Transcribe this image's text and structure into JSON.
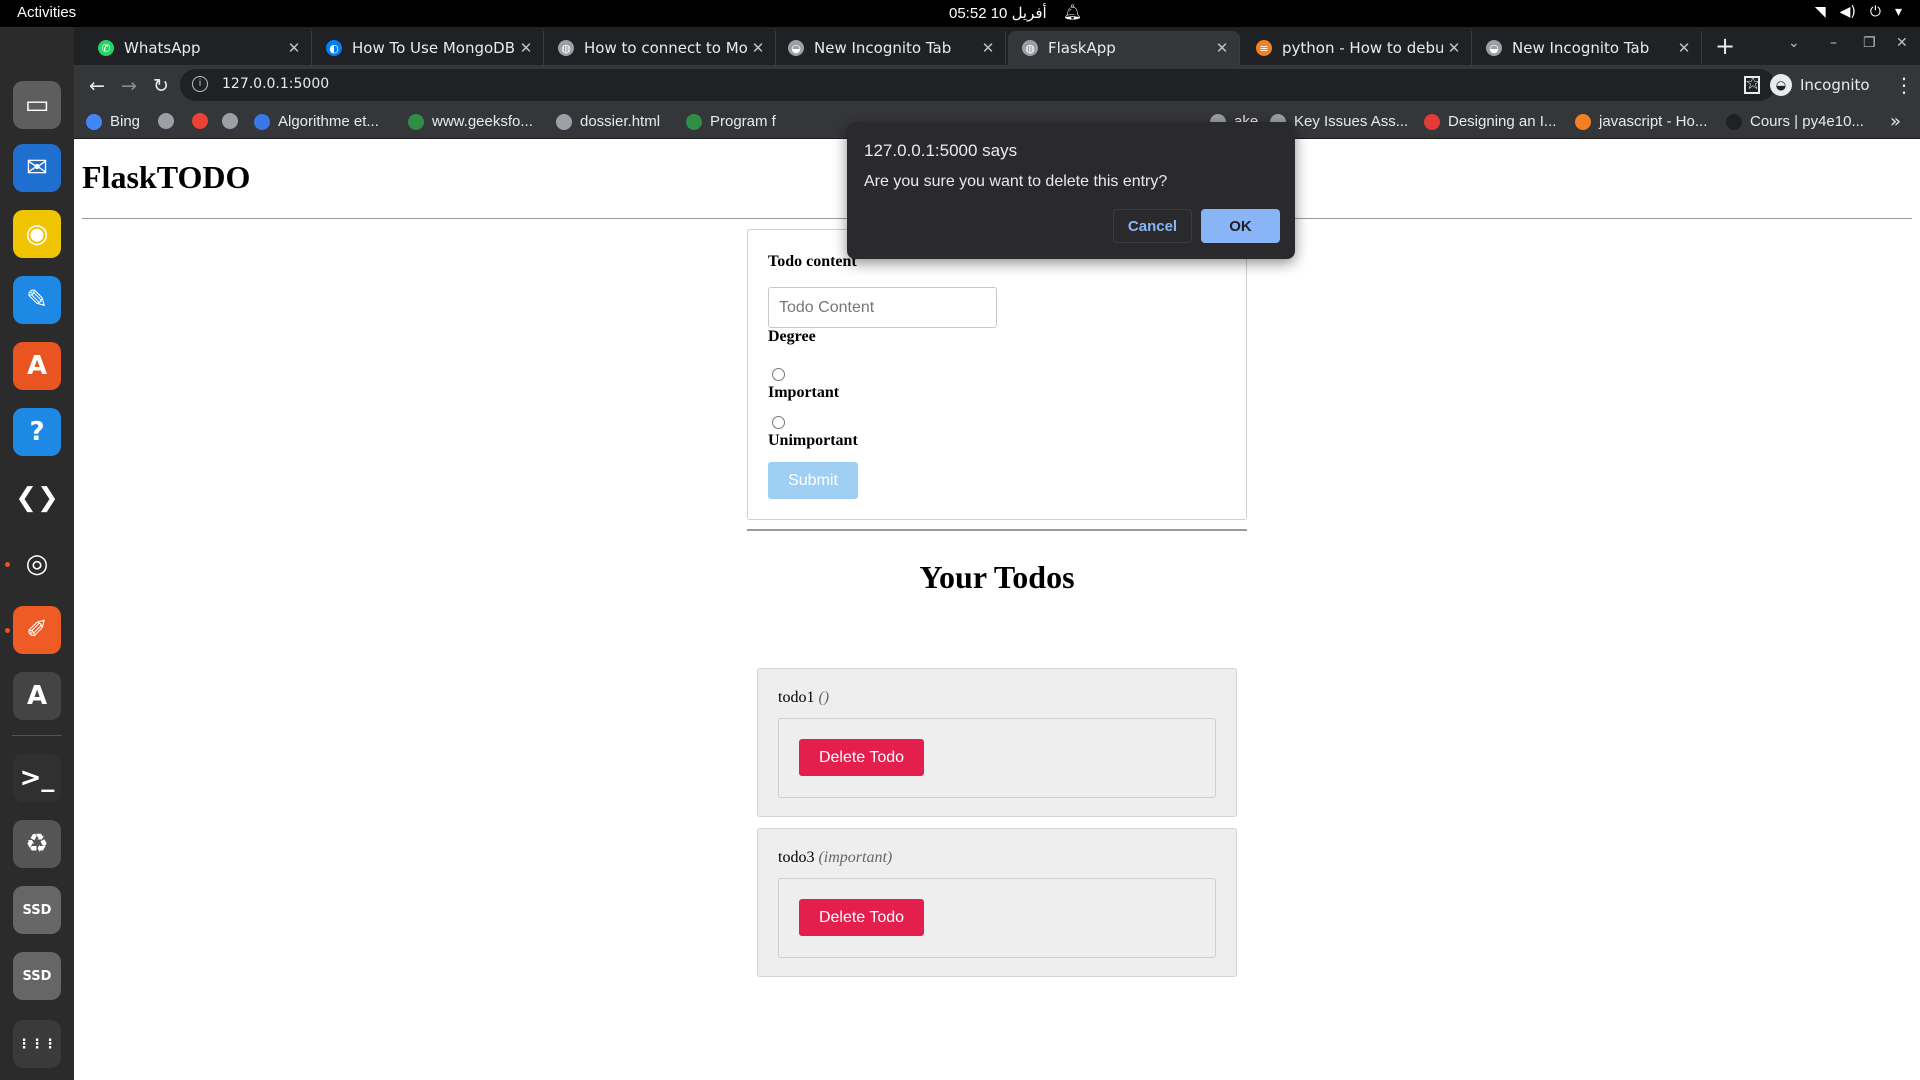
{
  "topbar": {
    "activities": "Activities",
    "clock": "05:52  أفريل 10"
  },
  "tabs": [
    {
      "label": "WhatsApp",
      "icon": "whatsapp-icon",
      "color": "#25d366",
      "glyph": "✆"
    },
    {
      "label": "How To Use MongoDB in",
      "icon": "digitalocean-icon",
      "color": "#0080ff",
      "glyph": "◐"
    },
    {
      "label": "How to connect to Mong",
      "icon": "globe-icon",
      "color": "#9aa0a6",
      "glyph": "◍"
    },
    {
      "label": "New Incognito Tab",
      "icon": "incognito-icon",
      "color": "#9aa0a6",
      "glyph": "◒"
    },
    {
      "label": "FlaskApp",
      "icon": "globe-icon",
      "color": "#9aa0a6",
      "glyph": "◍"
    },
    {
      "label": "python - How to debug a",
      "icon": "stackoverflow-icon",
      "color": "#f48024",
      "glyph": "≡"
    },
    {
      "label": "New Incognito Tab",
      "icon": "incognito-icon",
      "color": "#9aa0a6",
      "glyph": "◒"
    }
  ],
  "omnibox": {
    "url": "127.0.0.1:5000"
  },
  "profile": {
    "label": "Incognito"
  },
  "bookmarks": [
    {
      "label": "Bing",
      "icon": "bing-icon",
      "color": "#4285f4"
    },
    {
      "label": "",
      "icon": "globe-icon",
      "color": "#9aa0a6"
    },
    {
      "label": "",
      "icon": "gmail-icon",
      "color": "#ea4335"
    },
    {
      "label": "",
      "icon": "globe-icon",
      "color": "#9aa0a6"
    },
    {
      "label": "Algorithme et...",
      "icon": "algo-icon",
      "color": "#3b78e7"
    },
    {
      "label": "www.geeksfo...",
      "icon": "geeksforgeeks-icon",
      "color": "#2f8d46"
    },
    {
      "label": "dossier.html",
      "icon": "globe-icon",
      "color": "#9aa0a6"
    },
    {
      "label": "Program f",
      "icon": "geeksforgeeks-icon",
      "color": "#2f8d46"
    },
    {
      "label": "ake...",
      "icon": "page-icon",
      "color": "#9aa0a6"
    },
    {
      "label": "Key Issues Ass...",
      "icon": "globe-icon",
      "color": "#9aa0a6"
    },
    {
      "label": "Designing an I...",
      "icon": "designing-icon",
      "color": "#e53935"
    },
    {
      "label": "javascript - Ho...",
      "icon": "stackoverflow-icon",
      "color": "#f48024"
    },
    {
      "label": "Cours | py4e10...",
      "icon": "x-icon",
      "color": "#202124"
    }
  ],
  "page": {
    "brand": "FlaskTODO",
    "form": {
      "content_label": "Todo content",
      "content_placeholder": "Todo Content",
      "degree_label": "Degree",
      "option_important": "Important",
      "option_unimportant": "Unimportant",
      "submit": "Submit"
    },
    "todos_heading": "Your Todos",
    "todos": [
      {
        "title": "todo1",
        "degree": "()",
        "delete": "Delete Todo"
      },
      {
        "title": "todo3",
        "degree": "(important)",
        "delete": "Delete Todo"
      }
    ]
  },
  "dialog": {
    "title": "127.0.0.1:5000 says",
    "message": "Are you sure you want to delete this entry?",
    "cancel": "Cancel",
    "ok": "OK"
  },
  "dock": [
    {
      "name": "files-icon",
      "color": "#5e5e5e",
      "glyph": "▭"
    },
    {
      "name": "thunderbird-icon",
      "color": "#1f6fd1",
      "glyph": "✉"
    },
    {
      "name": "rhythmbox-icon",
      "color": "#f0c400",
      "glyph": "◉"
    },
    {
      "name": "writer-icon",
      "color": "#1e88e5",
      "glyph": "✎"
    },
    {
      "name": "software-icon",
      "color": "#e95420",
      "glyph": "A"
    },
    {
      "name": "help-icon",
      "color": "#1e88e5",
      "glyph": "?"
    },
    {
      "name": "vscode-icon",
      "color": "#2b2b2b",
      "glyph": "❮❯"
    },
    {
      "name": "chrome-icon",
      "color": "#2b2b2b",
      "glyph": "◎"
    },
    {
      "name": "postman-icon",
      "color": "#ef5b25",
      "glyph": "✐"
    },
    {
      "name": "updater-icon",
      "color": "#444",
      "glyph": "A"
    },
    {
      "name": "terminal-icon",
      "color": "#303030",
      "glyph": ">_"
    },
    {
      "name": "trash-icon",
      "color": "#555",
      "glyph": "♻"
    },
    {
      "name": "ssd-drive-icon",
      "color": "#666",
      "glyph": "SSD"
    },
    {
      "name": "ssd-drive-icon",
      "color": "#666",
      "glyph": "SSD"
    },
    {
      "name": "app-grid-icon",
      "color": "#3a3a3a",
      "glyph": "⋮⋮⋮"
    }
  ]
}
